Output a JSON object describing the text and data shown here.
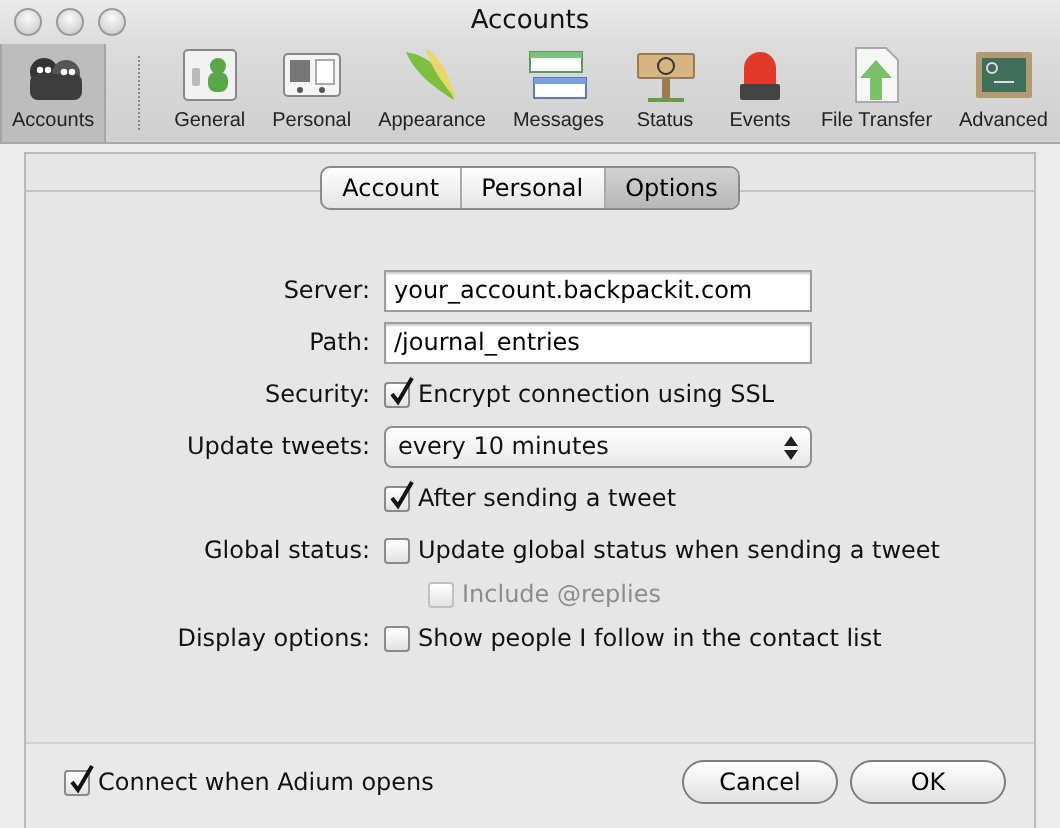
{
  "window": {
    "title": "Accounts"
  },
  "toolbar": [
    {
      "label": "Accounts",
      "selected": true
    },
    {
      "label": "General",
      "selected": false
    },
    {
      "label": "Personal",
      "selected": false
    },
    {
      "label": "Appearance",
      "selected": false
    },
    {
      "label": "Messages",
      "selected": false
    },
    {
      "label": "Status",
      "selected": false
    },
    {
      "label": "Events",
      "selected": false
    },
    {
      "label": "File Transfer",
      "selected": false
    },
    {
      "label": "Advanced",
      "selected": false
    }
  ],
  "tabs": [
    {
      "label": "Account",
      "selected": false
    },
    {
      "label": "Personal",
      "selected": false
    },
    {
      "label": "Options",
      "selected": true
    }
  ],
  "form": [
    {
      "kind": "text",
      "label": "Server:",
      "value": "your_account.backpackit.com"
    },
    {
      "kind": "text",
      "label": "Path:",
      "value": "/journal_entries"
    },
    {
      "kind": "checkbox",
      "label": "Security:",
      "text": "Encrypt connection using SSL",
      "checked": true,
      "disabled": false,
      "indented": false
    },
    {
      "kind": "select",
      "label": "Update tweets:",
      "value": "every 10 minutes"
    },
    {
      "kind": "checkbox",
      "text": "After sending a tweet",
      "checked": true,
      "disabled": false,
      "indented": false
    },
    {
      "kind": "checkbox",
      "label": "Global status:",
      "text": "Update global status when sending a tweet",
      "checked": false,
      "disabled": false,
      "indented": false
    },
    {
      "kind": "checkbox",
      "text": "Include @replies",
      "checked": false,
      "disabled": true,
      "indented": true
    },
    {
      "kind": "checkbox",
      "label": "Display options:",
      "text": "Show people I follow in the contact list",
      "checked": false,
      "disabled": false,
      "indented": false
    }
  ],
  "footer": {
    "checkbox": {
      "text": "Connect when Adium opens",
      "checked": true
    },
    "buttons": [
      "Cancel",
      "OK"
    ]
  }
}
